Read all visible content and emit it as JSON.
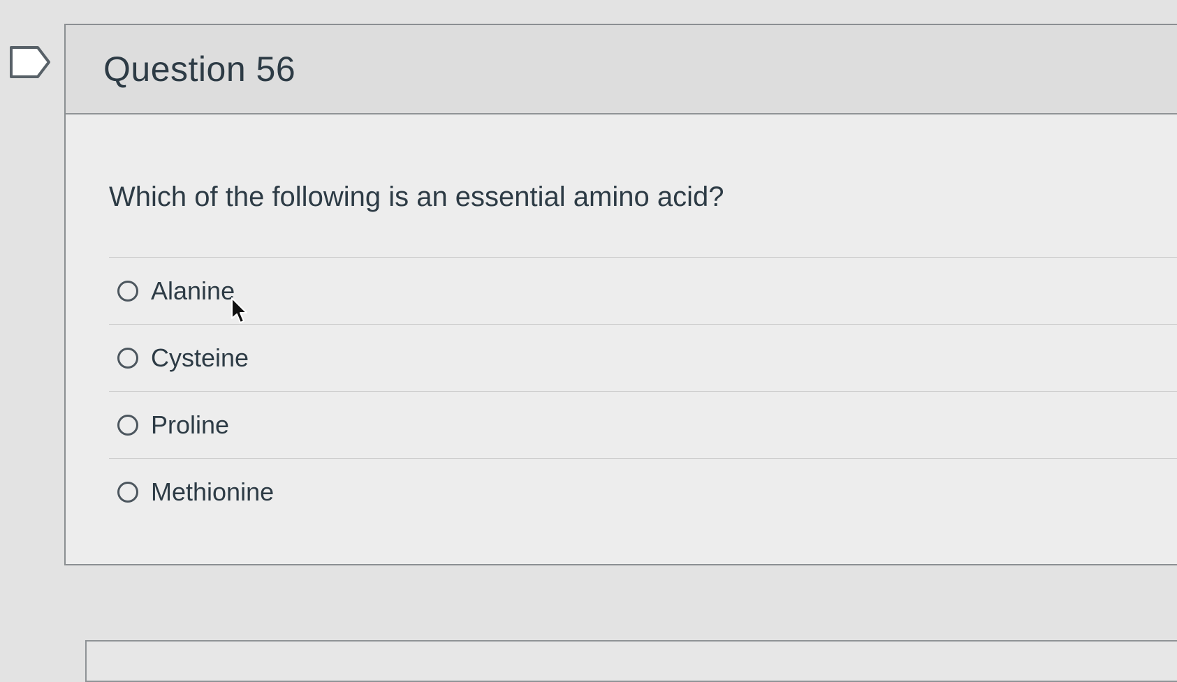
{
  "question": {
    "title": "Question 56",
    "text": "Which of the following is an essential amino acid?",
    "answers": [
      {
        "label": "Alanine"
      },
      {
        "label": "Cysteine"
      },
      {
        "label": "Proline"
      },
      {
        "label": "Methionine"
      }
    ]
  },
  "icons": {
    "flag": "flag-icon",
    "radio": "radio-icon",
    "cursor": "cursor-icon"
  }
}
